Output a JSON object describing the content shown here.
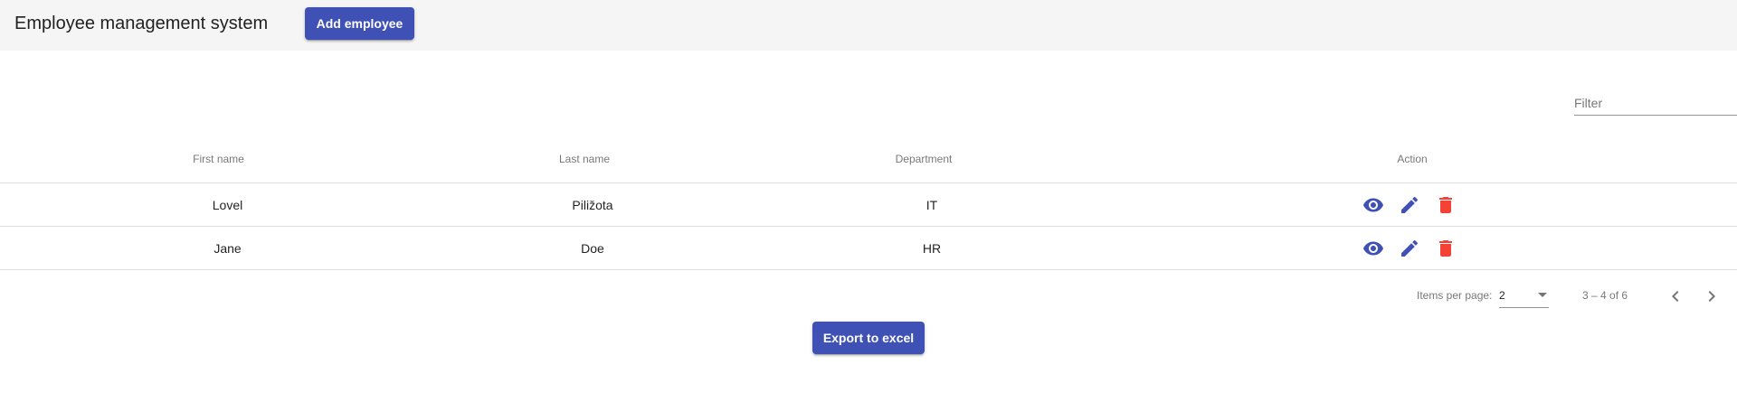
{
  "header": {
    "title": "Employee management system",
    "add_button_label": "Add employee"
  },
  "filter": {
    "placeholder": "Filter",
    "value": ""
  },
  "table": {
    "columns": [
      "First name",
      "Last name",
      "Department",
      "Action"
    ],
    "rows": [
      {
        "first_name": "Lovel",
        "last_name": "Piližota",
        "department": "IT"
      },
      {
        "first_name": "Jane",
        "last_name": "Doe",
        "department": "HR"
      }
    ],
    "action_icons": [
      "eye-icon",
      "pencil-icon",
      "trash-icon"
    ]
  },
  "paginator": {
    "items_per_page_label": "Items per page:",
    "items_per_page_value": "2",
    "range_label": "3 – 4 of 6"
  },
  "export_button_label": "Export to excel",
  "colors": {
    "primary": "#3f51b5",
    "warn": "#f44336",
    "toolbar_bg": "#f5f5f5"
  }
}
